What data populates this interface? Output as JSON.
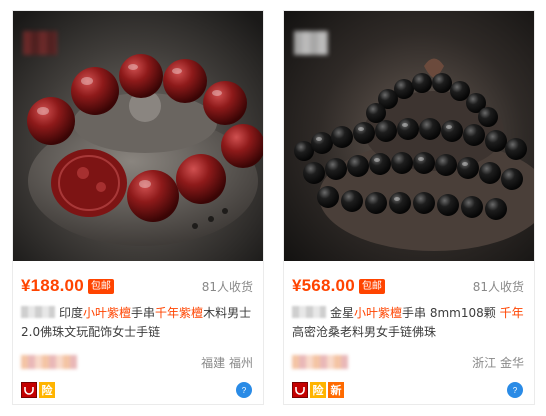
{
  "products": [
    {
      "price": "¥188.00",
      "badge": "包邮",
      "sold": "81人收货",
      "title_parts": [
        "印度",
        "小叶紫檀",
        "手串",
        "千年紫檀",
        "木料男士2.0佛珠文玩配饰女士手链"
      ],
      "location": "福建 福州",
      "service_icons": [
        "tmall-icon",
        "bao"
      ],
      "service_labels": [
        "险"
      ]
    },
    {
      "price": "¥568.00",
      "badge": "包邮",
      "sold": "81人收货",
      "title_parts": [
        "金星",
        "小叶紫檀",
        "手串 8mm108颗 ",
        "千年",
        "高密沧桑老料男女手链佛珠"
      ],
      "location": "浙江 金华",
      "service_icons": [
        "tmall-icon",
        "bao",
        "xin"
      ],
      "service_labels": [
        "险",
        "新"
      ]
    }
  ],
  "colors": {
    "accent": "#ff4400",
    "tmall": "#c40000",
    "bao": "#ffb400",
    "xin": "#ff6a00",
    "wangwang": "#2a8be6"
  }
}
